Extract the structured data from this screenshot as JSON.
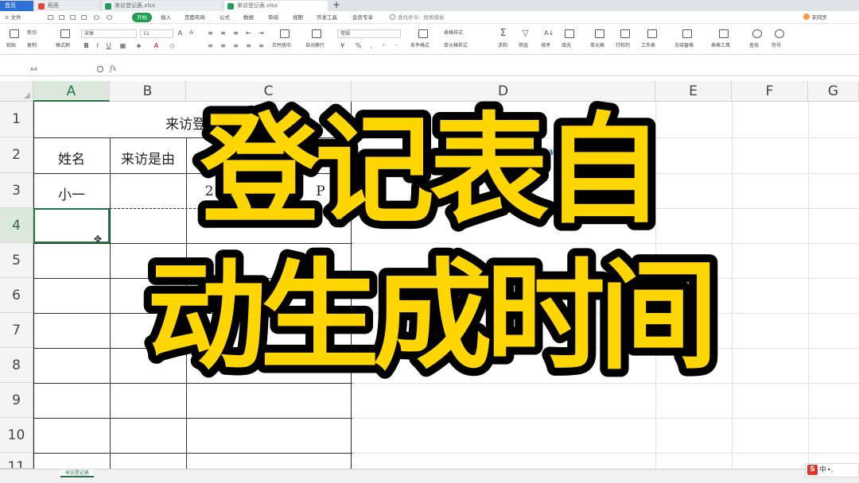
{
  "tabs": [
    {
      "label": "首页",
      "active": false
    },
    {
      "label": "稻壳",
      "active": false
    },
    {
      "label": "来访登记表.xlsx",
      "active": false
    },
    {
      "label": "来访登记表.xlsx",
      "active": true
    }
  ],
  "tab_add": "+",
  "menu": {
    "file": "≡ 文件",
    "items": [
      "开始",
      "插入",
      "页面布局",
      "公式",
      "数据",
      "审阅",
      "视图",
      "开发工具",
      "会员专享"
    ],
    "active_item": "开始",
    "search_placeholder": "查找命令、搜索模板",
    "sync_status": "未同步"
  },
  "ribbon": {
    "paste": "粘贴",
    "cut": "剪切",
    "copy": "复制",
    "format_painter": "格式刷",
    "font_name": "宋体",
    "font_size": "11",
    "number_format": "常规",
    "merge": "合并居中",
    "wrap": "自动换行",
    "conditional_format": "条件格式",
    "table_style": "表格样式",
    "cell_style": "单元格样式",
    "sum": "求和",
    "filter": "筛选",
    "sort": "排序",
    "fill": "填充",
    "cell": "单元格",
    "row_col": "行和列",
    "worksheet": "工作表",
    "freeze": "冻结窗格",
    "table_tools": "表格工具",
    "find": "查找",
    "symbol": "符号"
  },
  "formula_bar": {
    "cell_ref": "A4",
    "fx": "fx",
    "value": ""
  },
  "columns": [
    "A",
    "B",
    "C",
    "D",
    "E",
    "F",
    "G"
  ],
  "selected_column": "A",
  "rows": [
    "1",
    "2",
    "3",
    "4",
    "5",
    "6",
    "7",
    "8",
    "9",
    "10",
    "11"
  ],
  "selected_row": "4",
  "table": {
    "title": "来访登记",
    "header_name": "姓名",
    "header_reason": "来访是由",
    "row3_name": "小一",
    "row3_c_partial": "2",
    "row3_c_right_partial": "P",
    "row2_d_partial": "W"
  },
  "overlay": {
    "line1": "登记表自",
    "line2": "动生成时间",
    "fill_color": "#ffd600",
    "stroke_color": "#000000"
  },
  "sheet_tab": "来访登记表",
  "ime": {
    "logo": "S",
    "lang": "中",
    "punct": "•,"
  }
}
